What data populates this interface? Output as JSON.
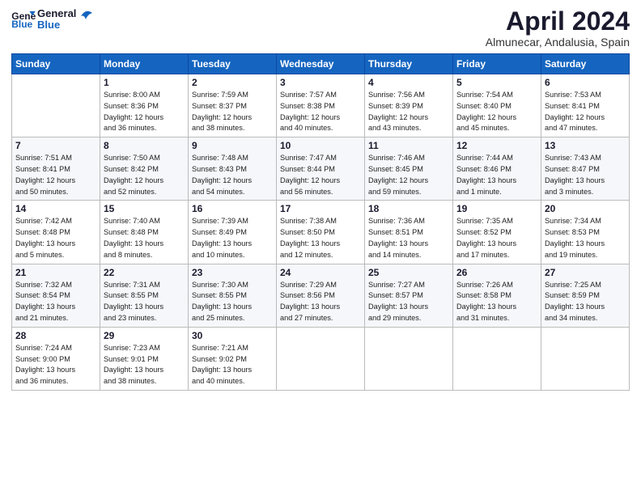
{
  "header": {
    "logo_line1": "General",
    "logo_line2": "Blue",
    "title": "April 2024",
    "location": "Almunecar, Andalusia, Spain"
  },
  "columns": [
    "Sunday",
    "Monday",
    "Tuesday",
    "Wednesday",
    "Thursday",
    "Friday",
    "Saturday"
  ],
  "weeks": [
    [
      {
        "day": "",
        "info": ""
      },
      {
        "day": "1",
        "info": "Sunrise: 8:00 AM\nSunset: 8:36 PM\nDaylight: 12 hours\nand 36 minutes."
      },
      {
        "day": "2",
        "info": "Sunrise: 7:59 AM\nSunset: 8:37 PM\nDaylight: 12 hours\nand 38 minutes."
      },
      {
        "day": "3",
        "info": "Sunrise: 7:57 AM\nSunset: 8:38 PM\nDaylight: 12 hours\nand 40 minutes."
      },
      {
        "day": "4",
        "info": "Sunrise: 7:56 AM\nSunset: 8:39 PM\nDaylight: 12 hours\nand 43 minutes."
      },
      {
        "day": "5",
        "info": "Sunrise: 7:54 AM\nSunset: 8:40 PM\nDaylight: 12 hours\nand 45 minutes."
      },
      {
        "day": "6",
        "info": "Sunrise: 7:53 AM\nSunset: 8:41 PM\nDaylight: 12 hours\nand 47 minutes."
      }
    ],
    [
      {
        "day": "7",
        "info": "Sunrise: 7:51 AM\nSunset: 8:41 PM\nDaylight: 12 hours\nand 50 minutes."
      },
      {
        "day": "8",
        "info": "Sunrise: 7:50 AM\nSunset: 8:42 PM\nDaylight: 12 hours\nand 52 minutes."
      },
      {
        "day": "9",
        "info": "Sunrise: 7:48 AM\nSunset: 8:43 PM\nDaylight: 12 hours\nand 54 minutes."
      },
      {
        "day": "10",
        "info": "Sunrise: 7:47 AM\nSunset: 8:44 PM\nDaylight: 12 hours\nand 56 minutes."
      },
      {
        "day": "11",
        "info": "Sunrise: 7:46 AM\nSunset: 8:45 PM\nDaylight: 12 hours\nand 59 minutes."
      },
      {
        "day": "12",
        "info": "Sunrise: 7:44 AM\nSunset: 8:46 PM\nDaylight: 13 hours\nand 1 minute."
      },
      {
        "day": "13",
        "info": "Sunrise: 7:43 AM\nSunset: 8:47 PM\nDaylight: 13 hours\nand 3 minutes."
      }
    ],
    [
      {
        "day": "14",
        "info": "Sunrise: 7:42 AM\nSunset: 8:48 PM\nDaylight: 13 hours\nand 5 minutes."
      },
      {
        "day": "15",
        "info": "Sunrise: 7:40 AM\nSunset: 8:48 PM\nDaylight: 13 hours\nand 8 minutes."
      },
      {
        "day": "16",
        "info": "Sunrise: 7:39 AM\nSunset: 8:49 PM\nDaylight: 13 hours\nand 10 minutes."
      },
      {
        "day": "17",
        "info": "Sunrise: 7:38 AM\nSunset: 8:50 PM\nDaylight: 13 hours\nand 12 minutes."
      },
      {
        "day": "18",
        "info": "Sunrise: 7:36 AM\nSunset: 8:51 PM\nDaylight: 13 hours\nand 14 minutes."
      },
      {
        "day": "19",
        "info": "Sunrise: 7:35 AM\nSunset: 8:52 PM\nDaylight: 13 hours\nand 17 minutes."
      },
      {
        "day": "20",
        "info": "Sunrise: 7:34 AM\nSunset: 8:53 PM\nDaylight: 13 hours\nand 19 minutes."
      }
    ],
    [
      {
        "day": "21",
        "info": "Sunrise: 7:32 AM\nSunset: 8:54 PM\nDaylight: 13 hours\nand 21 minutes."
      },
      {
        "day": "22",
        "info": "Sunrise: 7:31 AM\nSunset: 8:55 PM\nDaylight: 13 hours\nand 23 minutes."
      },
      {
        "day": "23",
        "info": "Sunrise: 7:30 AM\nSunset: 8:55 PM\nDaylight: 13 hours\nand 25 minutes."
      },
      {
        "day": "24",
        "info": "Sunrise: 7:29 AM\nSunset: 8:56 PM\nDaylight: 13 hours\nand 27 minutes."
      },
      {
        "day": "25",
        "info": "Sunrise: 7:27 AM\nSunset: 8:57 PM\nDaylight: 13 hours\nand 29 minutes."
      },
      {
        "day": "26",
        "info": "Sunrise: 7:26 AM\nSunset: 8:58 PM\nDaylight: 13 hours\nand 31 minutes."
      },
      {
        "day": "27",
        "info": "Sunrise: 7:25 AM\nSunset: 8:59 PM\nDaylight: 13 hours\nand 34 minutes."
      }
    ],
    [
      {
        "day": "28",
        "info": "Sunrise: 7:24 AM\nSunset: 9:00 PM\nDaylight: 13 hours\nand 36 minutes."
      },
      {
        "day": "29",
        "info": "Sunrise: 7:23 AM\nSunset: 9:01 PM\nDaylight: 13 hours\nand 38 minutes."
      },
      {
        "day": "30",
        "info": "Sunrise: 7:21 AM\nSunset: 9:02 PM\nDaylight: 13 hours\nand 40 minutes."
      },
      {
        "day": "",
        "info": ""
      },
      {
        "day": "",
        "info": ""
      },
      {
        "day": "",
        "info": ""
      },
      {
        "day": "",
        "info": ""
      }
    ]
  ]
}
